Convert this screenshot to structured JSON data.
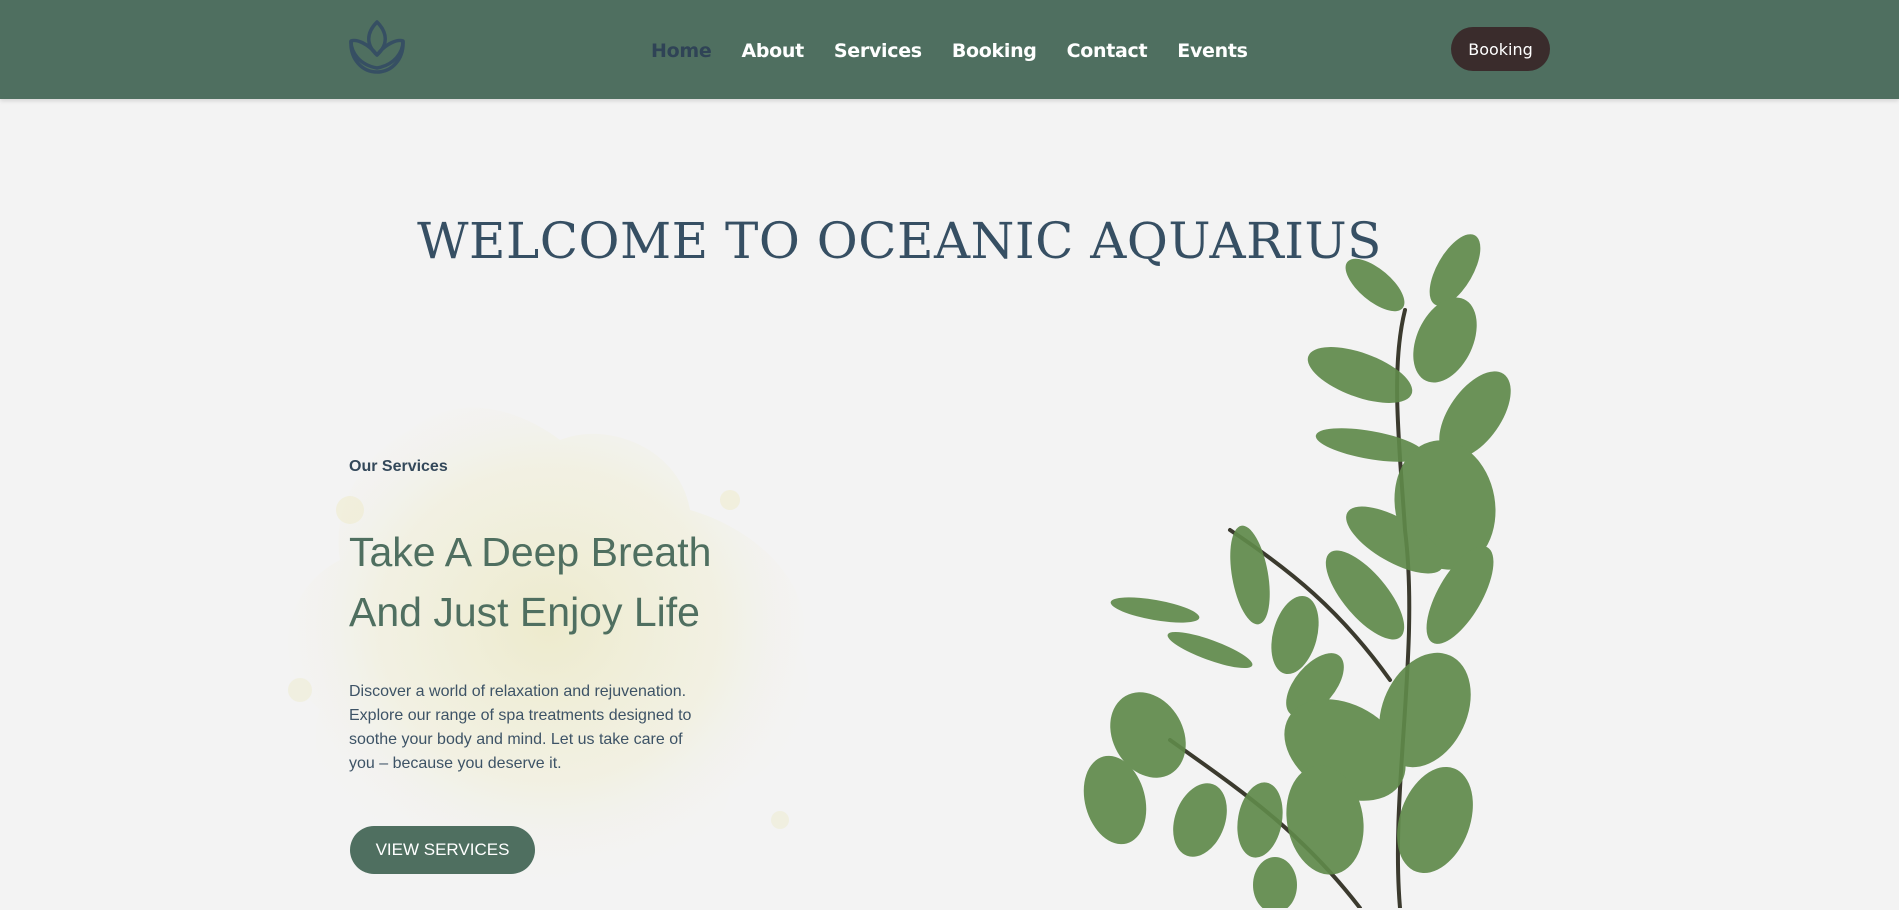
{
  "nav": {
    "links": [
      "Home",
      "About",
      "Services",
      "Booking",
      "Contact",
      "Events"
    ],
    "active": "Home",
    "booking_button": "Booking"
  },
  "hero": {
    "welcome_title": "WELCOME TO OCEANIC AQUARIUS",
    "subheading": "Our Services",
    "title_line1": "Take A Deep Breath",
    "title_line2": "And Just Enjoy Life",
    "description": "Discover a world of relaxation and rejuvenation. Explore our range of spa treatments designed to soothe your body and mind. Let us take care of you – because you deserve it.",
    "cta": "VIEW SERVICES"
  },
  "colors": {
    "nav_bg": "#4f6f60",
    "accent_dark": "#3a2c2c",
    "heading": "#364f63",
    "hero_title": "#4f6f60",
    "background": "#f3f3f3"
  },
  "icons": [
    "lotus-logo-icon",
    "eucalyptus-plant-image",
    "watercolor-splash-image"
  ]
}
